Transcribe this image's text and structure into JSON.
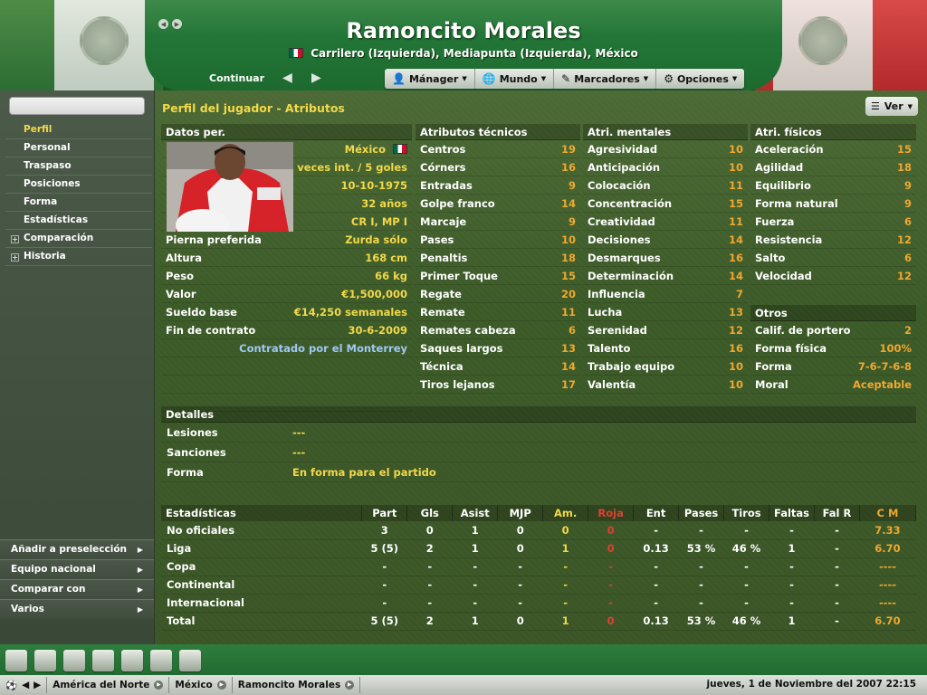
{
  "header": {
    "player_name": "Ramoncito Morales",
    "positions": "Carrilero (Izquierda), Mediapunta (Izquierda), México"
  },
  "menubar": {
    "continue": "Continuar",
    "items": [
      {
        "label": "Mánager",
        "icon": "person-icon"
      },
      {
        "label": "Mundo",
        "icon": "globe-icon"
      },
      {
        "label": "Marcadores",
        "icon": "pen-icon"
      },
      {
        "label": "Opciones",
        "icon": "gears-icon"
      }
    ]
  },
  "sidebar": {
    "items": [
      {
        "label": "Perfil",
        "active": true
      },
      {
        "label": "Personal"
      },
      {
        "label": "Traspaso"
      },
      {
        "label": "Posiciones"
      },
      {
        "label": "Forma"
      },
      {
        "label": "Estadísticas"
      },
      {
        "label": "Comparación",
        "expandable": true
      },
      {
        "label": "Historia",
        "expandable": true
      }
    ],
    "actions": [
      "Añadir a preselección",
      "Equipo nacional",
      "Comparar con",
      "Varios"
    ]
  },
  "panel": {
    "title": "Perfil del jugador - Atributos",
    "view_button": "Ver"
  },
  "personal": {
    "header": "Datos per.",
    "nationality": "México",
    "caps": "48 veces int. / 5 goles",
    "birth_date": "10-10-1975",
    "age": "32 años",
    "position_short": "CR I, MP I",
    "rows": [
      {
        "label": "Pierna preferida",
        "value": "Zurda sólo"
      },
      {
        "label": "Altura",
        "value": "168 cm"
      },
      {
        "label": "Peso",
        "value": "66 kg"
      },
      {
        "label": "Valor",
        "value": "€1,500,000"
      },
      {
        "label": "Sueldo base",
        "value": "€14,250 semanales"
      },
      {
        "label": "Fin de contrato",
        "value": "30-6-2009"
      }
    ],
    "contract_note": "Contratado por el Monterrey"
  },
  "technical": {
    "header": "Atributos técnicos",
    "rows": [
      {
        "label": "Centros",
        "value": "19"
      },
      {
        "label": "Córners",
        "value": "16"
      },
      {
        "label": "Entradas",
        "value": "9"
      },
      {
        "label": "Golpe franco",
        "value": "14"
      },
      {
        "label": "Marcaje",
        "value": "9"
      },
      {
        "label": "Pases",
        "value": "10"
      },
      {
        "label": "Penaltis",
        "value": "18"
      },
      {
        "label": "Primer Toque",
        "value": "15"
      },
      {
        "label": "Regate",
        "value": "20"
      },
      {
        "label": "Remate",
        "value": "11"
      },
      {
        "label": "Remates cabeza",
        "value": "6"
      },
      {
        "label": "Saques largos",
        "value": "13"
      },
      {
        "label": "Técnica",
        "value": "14"
      },
      {
        "label": "Tiros lejanos",
        "value": "17"
      }
    ]
  },
  "mental": {
    "header": "Atri. mentales",
    "rows": [
      {
        "label": "Agresividad",
        "value": "10"
      },
      {
        "label": "Anticipación",
        "value": "10"
      },
      {
        "label": "Colocación",
        "value": "11"
      },
      {
        "label": "Concentración",
        "value": "15"
      },
      {
        "label": "Creatividad",
        "value": "11"
      },
      {
        "label": "Decisiones",
        "value": "14"
      },
      {
        "label": "Desmarques",
        "value": "16"
      },
      {
        "label": "Determinación",
        "value": "14"
      },
      {
        "label": "Influencia",
        "value": "7"
      },
      {
        "label": "Lucha",
        "value": "13"
      },
      {
        "label": "Serenidad",
        "value": "12"
      },
      {
        "label": "Talento",
        "value": "16"
      },
      {
        "label": "Trabajo equipo",
        "value": "10"
      },
      {
        "label": "Valentía",
        "value": "10"
      }
    ]
  },
  "physical": {
    "header": "Atri. físicos",
    "rows": [
      {
        "label": "Aceleración",
        "value": "15"
      },
      {
        "label": "Agilidad",
        "value": "18"
      },
      {
        "label": "Equilibrio",
        "value": "9"
      },
      {
        "label": "Forma natural",
        "value": "9"
      },
      {
        "label": "Fuerza",
        "value": "6"
      },
      {
        "label": "Resistencia",
        "value": "12"
      },
      {
        "label": "Salto",
        "value": "6"
      },
      {
        "label": "Velocidad",
        "value": "12"
      }
    ]
  },
  "others": {
    "header": "Otros",
    "rows": [
      {
        "label": "Calif. de portero",
        "value": "2"
      },
      {
        "label": "Forma física",
        "value": "100%"
      },
      {
        "label": "Forma",
        "value": "7-6-7-6-8"
      },
      {
        "label": "Moral",
        "value": "Aceptable"
      }
    ]
  },
  "details": {
    "header": "Detalles",
    "rows": [
      {
        "label": "Lesiones",
        "value": "---"
      },
      {
        "label": "Sanciones",
        "value": "---"
      },
      {
        "label": "Forma",
        "value": "En forma para el partido"
      }
    ]
  },
  "stats": {
    "columns": [
      "Estadísticas",
      "Part",
      "Gls",
      "Asist",
      "MJP",
      "Am.",
      "Roja",
      "Ent",
      "Pases",
      "Tiros",
      "Faltas",
      "Fal R",
      "C M"
    ],
    "rows": [
      [
        "No oficiales",
        "3",
        "0",
        "1",
        "0",
        "0",
        "0",
        "-",
        "-",
        "-",
        "-",
        "-",
        "7.33"
      ],
      [
        "Liga",
        "5 (5)",
        "2",
        "1",
        "0",
        "1",
        "0",
        "0.13",
        "53 %",
        "46 %",
        "1",
        "-",
        "6.70"
      ],
      [
        "Copa",
        "-",
        "-",
        "-",
        "-",
        "-",
        "-",
        "-",
        "-",
        "-",
        "-",
        "-",
        "----"
      ],
      [
        "Continental",
        "-",
        "-",
        "-",
        "-",
        "-",
        "-",
        "-",
        "-",
        "-",
        "-",
        "-",
        "----"
      ],
      [
        "Internacional",
        "-",
        "-",
        "-",
        "-",
        "-",
        "-",
        "-",
        "-",
        "-",
        "-",
        "-",
        "----"
      ],
      [
        "Total",
        "5 (5)",
        "2",
        "1",
        "0",
        "1",
        "0",
        "0.13",
        "53 %",
        "46 %",
        "1",
        "-",
        "6.70"
      ]
    ]
  },
  "statusbar": {
    "crumbs": [
      "América del Norte",
      "México",
      "Ramoncito Morales"
    ],
    "date": "jueves, 1 de Noviembre del 2007 22:15"
  },
  "colors": {
    "accent_yellow": "#f2d84a",
    "value_orange": "#f0a830",
    "red_card": "#e04030"
  }
}
